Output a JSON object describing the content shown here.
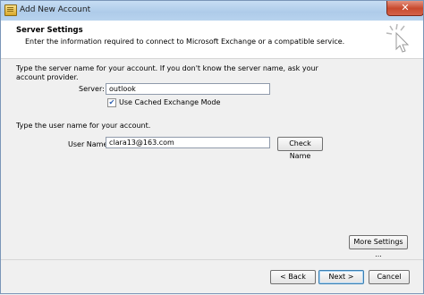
{
  "window": {
    "title": "Add New Account",
    "close_glyph": "✕"
  },
  "header": {
    "title": "Server Settings",
    "description": "Enter the information required to connect to Microsoft Exchange or a compatible service."
  },
  "server_section": {
    "instruction_line1": "Type the server name for your account. If you don't know the server name, ask your",
    "instruction_line2": "account provider.",
    "server_label": "Server:",
    "server_value": "outlook",
    "cached_mode_label": "Use Cached Exchange Mode",
    "cached_mode_checked": true,
    "check_glyph": "✔"
  },
  "user_section": {
    "instruction": "Type the user name for your account.",
    "username_label": "User Name:",
    "username_value": "clara13@163.com",
    "check_name_button": "Check Name"
  },
  "more_settings_button": "More Settings ...",
  "footer": {
    "back_button": "< Back",
    "next_button": "Next >",
    "cancel_button": "Cancel"
  }
}
